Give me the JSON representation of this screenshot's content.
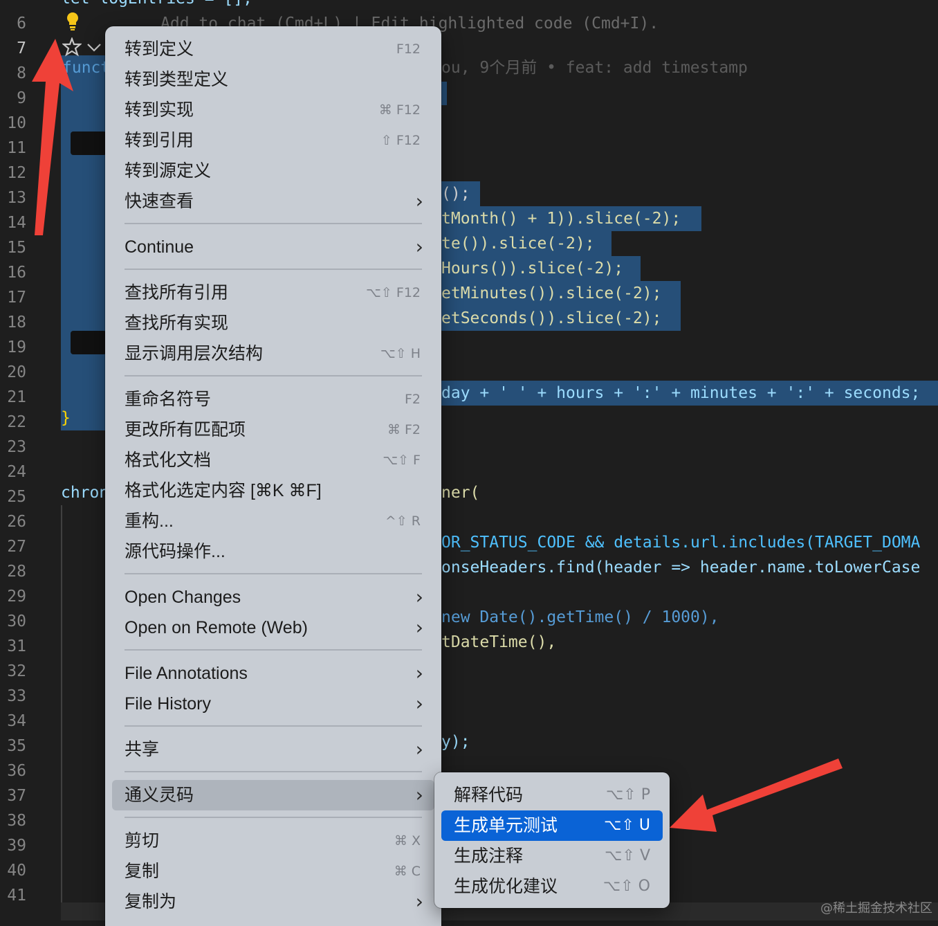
{
  "editor": {
    "line_numbers": [
      "6",
      "7",
      "8",
      "9",
      "10",
      "11",
      "12",
      "13",
      "14",
      "15",
      "16",
      "17",
      "18",
      "19",
      "20",
      "21",
      "22",
      "23",
      "24",
      "25",
      "26",
      "27",
      "28",
      "29",
      "30",
      "31",
      "32",
      "33",
      "34",
      "35",
      "36",
      "37",
      "38",
      "39",
      "40",
      "41"
    ],
    "active_line": "7",
    "top_partial_line": "let logEntries = [];",
    "ghost_hint": "Add to chat (Cmd+L) | Edit highlighted code (Cmd+I).",
    "line7_prefix": "funct",
    "blame": "ou, 9个月前 • feat: add timestamp",
    "line21": "}",
    "line24_prefix": "chron",
    "code_fragments": {
      "l12": "();",
      "l13": "tMonth() + 1)).slice(-2);",
      "l14": "te()).slice(-2);",
      "l15": "Hours()).slice(-2);",
      "l16": "etMinutes()).slice(-2);",
      "l17": "etSeconds()).slice(-2);",
      "l20": "day + ' ' + hours + ':' + minutes + ':' + seconds;",
      "l24": "ner(",
      "l26": "OR_STATUS_CODE && details.url.includes(TARGET_DOMA",
      "l27": "onseHeaders.find(header => header.name.toLowerCase",
      "l29": "new Date().getTime() / 1000),",
      "l30": "tDateTime(),",
      "l34": "y);"
    },
    "icons": [
      "lightbulb-icon",
      "sparkle-icon",
      "chevron-down-icon"
    ]
  },
  "context_menu": {
    "items": [
      {
        "label": "转到定义",
        "shortcut": "F12",
        "submenu": false
      },
      {
        "label": "转到类型定义",
        "shortcut": "",
        "submenu": false
      },
      {
        "label": "转到实现",
        "shortcut": "⌘ F12",
        "submenu": false
      },
      {
        "label": "转到引用",
        "shortcut": "⇧ F12",
        "submenu": false
      },
      {
        "label": "转到源定义",
        "shortcut": "",
        "submenu": false
      },
      {
        "label": "快速查看",
        "shortcut": "",
        "submenu": true
      },
      {
        "label": "Continue",
        "shortcut": "",
        "submenu": true
      },
      {
        "label": "查找所有引用",
        "shortcut": "⌥⇧ F12",
        "submenu": false
      },
      {
        "label": "查找所有实现",
        "shortcut": "",
        "submenu": false
      },
      {
        "label": "显示调用层次结构",
        "shortcut": "⌥⇧ H",
        "submenu": false
      },
      {
        "label": "重命名符号",
        "shortcut": "F2",
        "submenu": false
      },
      {
        "label": "更改所有匹配项",
        "shortcut": "⌘ F2",
        "submenu": false
      },
      {
        "label": "格式化文档",
        "shortcut": "⌥⇧ F",
        "submenu": false
      },
      {
        "label": "格式化选定内容 [⌘K ⌘F]",
        "shortcut": "",
        "submenu": false
      },
      {
        "label": "重构...",
        "shortcut": "^⇧ R",
        "submenu": false
      },
      {
        "label": "源代码操作...",
        "shortcut": "",
        "submenu": false
      },
      {
        "label": "Open Changes",
        "shortcut": "",
        "submenu": true
      },
      {
        "label": "Open on Remote (Web)",
        "shortcut": "",
        "submenu": true
      },
      {
        "label": "File Annotations",
        "shortcut": "",
        "submenu": true
      },
      {
        "label": "File History",
        "shortcut": "",
        "submenu": true
      },
      {
        "label": "共享",
        "shortcut": "",
        "submenu": true
      },
      {
        "label": "通义灵码",
        "shortcut": "",
        "submenu": true,
        "highlighted": true
      },
      {
        "label": "剪切",
        "shortcut": "⌘ X",
        "submenu": false
      },
      {
        "label": "复制",
        "shortcut": "⌘ C",
        "submenu": false
      },
      {
        "label": "复制为",
        "shortcut": "",
        "submenu": true
      }
    ],
    "chevron": "›"
  },
  "submenu": {
    "items": [
      {
        "label": "解释代码",
        "shortcut": "⌥⇧ P"
      },
      {
        "label": "生成单元测试",
        "shortcut": "⌥⇧ U",
        "active": true
      },
      {
        "label": "生成注释",
        "shortcut": "⌥⇧ V"
      },
      {
        "label": "生成优化建议",
        "shortcut": "⌥⇧ O"
      }
    ]
  },
  "annotation_color": "#ef4138",
  "selection_color": "#264f78",
  "submenu_active_color": "#0a63d6",
  "watermark": "@稀土掘金技术社区"
}
